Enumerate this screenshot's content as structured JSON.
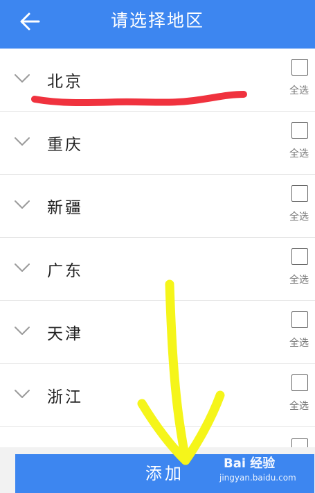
{
  "header": {
    "title": "请选择地区",
    "back_icon": "arrow-left-icon",
    "background": "#3d86f0"
  },
  "regions": [
    {
      "name": "北京",
      "select_all_label": "全选",
      "checked": false
    },
    {
      "name": "重庆",
      "select_all_label": "全选",
      "checked": false
    },
    {
      "name": "新疆",
      "select_all_label": "全选",
      "checked": false
    },
    {
      "name": "广东",
      "select_all_label": "全选",
      "checked": false
    },
    {
      "name": "天津",
      "select_all_label": "全选",
      "checked": false
    },
    {
      "name": "浙江",
      "select_all_label": "全选",
      "checked": false
    }
  ],
  "footer": {
    "add_label": "添加",
    "button_color": "#3d86f0"
  },
  "annotations": {
    "underline_color": "#f0323e",
    "arrow_color": "#f5f51a"
  },
  "watermark": {
    "logo_text": "Bai 经验",
    "url": "jingyan.baidu.com"
  }
}
